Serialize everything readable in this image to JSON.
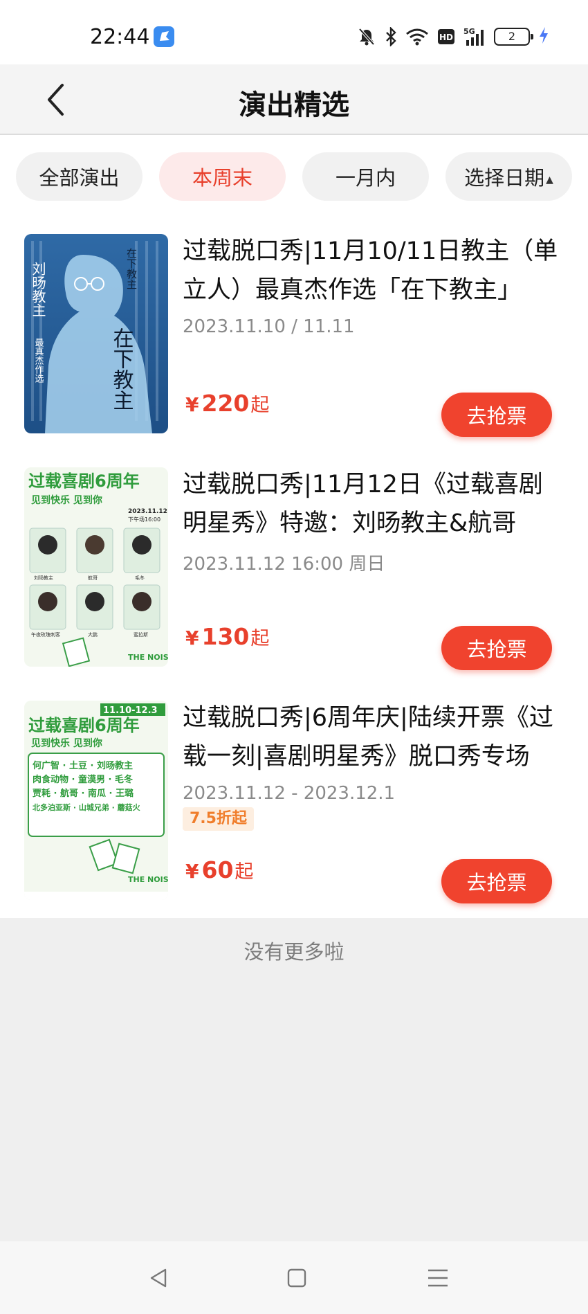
{
  "status_bar": {
    "time": "22:44",
    "battery_level": "2",
    "network": "5G",
    "hd_label": "HD",
    "icons": [
      "app-notification-icon",
      "mute-icon",
      "bluetooth-icon",
      "wifi-icon",
      "hd-icon",
      "signal-icon",
      "battery-icon",
      "charging-icon"
    ]
  },
  "header": {
    "title": "演出精选",
    "back_icon": "chevron-left-icon"
  },
  "filters": {
    "tabs": [
      {
        "label": "全部演出",
        "active": false
      },
      {
        "label": "本周末",
        "active": true
      },
      {
        "label": "一月内",
        "active": false
      },
      {
        "label": "选择日期",
        "active": false
      }
    ],
    "active_color": "#e8402c"
  },
  "shows": [
    {
      "title": "过载脱口秀|11月10/11日教主（单立人）最真杰作选「在下教主」",
      "date": "2023.11.10 / 11.11",
      "price_currency": "¥",
      "price_amount": "220",
      "price_suffix": "起",
      "buy_label": "去抢票",
      "poster": {
        "vertical_title": "刘旸教主",
        "vertical_sub": "最真杰作选",
        "big_title": "在下教主",
        "small_title": "在下教主"
      }
    },
    {
      "title": "过载脱口秀|11月12日《过载喜剧明星秀》特邀：刘旸教主&航哥",
      "date": "2023.11.12 16:00 周日",
      "price_currency": "¥",
      "price_amount": "130",
      "price_suffix": "起",
      "buy_label": "去抢票",
      "poster": {
        "headline": "过载喜剧6周年",
        "sub": "见到快乐 见到你",
        "date": "2023.11.12",
        "time": "下午场16:00",
        "guests": [
          "刘旸教主",
          "航哥",
          "毛冬",
          "午夜玫瑰刺客",
          "大鹏",
          "蜜拉斯"
        ],
        "footer": "THE NOISE"
      }
    },
    {
      "title": "过载脱口秀|6周年庆|陆续开票《过载一刻|喜剧明星秀》脱口秀专场",
      "date": "2023.11.12 - 2023.12.1",
      "discount": "7.5折起",
      "price_currency": "¥",
      "price_amount": "60",
      "price_suffix": "起",
      "buy_label": "去抢票",
      "poster": {
        "date_range": "11.10-12.3",
        "headline": "过载喜剧6周年",
        "sub": "见到快乐 见到你",
        "lineup": [
          "何广智 · 土豆 · 刘旸教主",
          "肉食动物 · 童漠男 · 毛冬",
          "贾耗 · 航哥 · 南瓜 · 王璐",
          "北多泊亚斯 · 山城兄弟 · 蘑菇火"
        ],
        "footer": "THE NOISE"
      }
    }
  ],
  "list_end_text": "没有更多啦",
  "nav_bar": {
    "buttons": [
      "back-triangle-icon",
      "home-square-icon",
      "menu-lines-icon"
    ]
  }
}
